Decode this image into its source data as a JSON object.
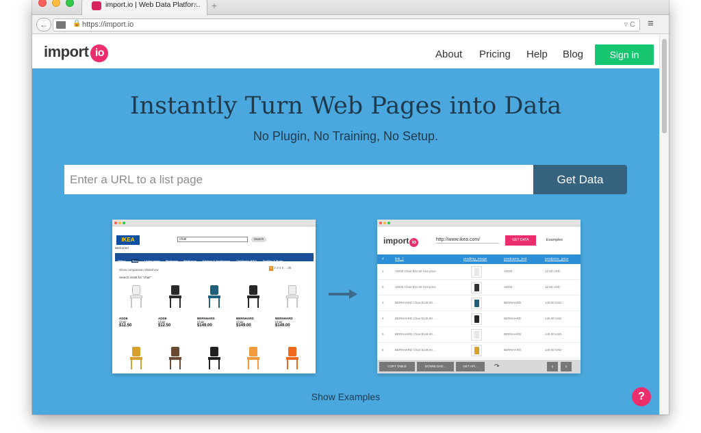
{
  "browser": {
    "tab_title": "import.io | Web Data Platfor…",
    "tab_close": "×",
    "new_tab": "+",
    "url": "https://import.io",
    "url_right": "▿ C",
    "menu": "≡",
    "back": "←"
  },
  "header": {
    "logo_text": "import",
    "logo_badge": "io",
    "nav": [
      "About",
      "Pricing",
      "Help",
      "Blog"
    ],
    "signin": "Sign in"
  },
  "hero": {
    "title": "Instantly Turn Web Pages into Data",
    "subtitle": "No Plugin, No Training, No Setup.",
    "input_placeholder": "Enter a URL to a list page",
    "cta": "Get Data"
  },
  "left_preview": {
    "logo": "IKEA",
    "welcome": "Welcome!",
    "search_value": "chair",
    "search_button": "Search",
    "menu": [
      "Offers",
      "New",
      "Living room",
      "Bedroom",
      "Bathroom",
      "Kitchen & Appliances",
      "Children's IKEA",
      "Textiles & Rugs"
    ],
    "tools": "Show comparison   Slideshow",
    "pages": [
      "1",
      "2",
      "3",
      "4",
      "5",
      "...",
      "25"
    ],
    "result_text": "Search result for \"chair\"",
    "products": [
      {
        "name": "ADDE",
        "type": "Chair",
        "price": "$12.50",
        "color": "#f0f0f0"
      },
      {
        "name": "ADDE",
        "type": "Chair",
        "price": "$12.50",
        "color": "#2a2a2a"
      },
      {
        "name": "BERNHARD",
        "type": "Chair",
        "price": "$149.00",
        "color": "#1f5f7a"
      },
      {
        "name": "BERNHARD",
        "type": "Chair",
        "price": "$149.00",
        "color": "#262626"
      },
      {
        "name": "BERNHARD",
        "type": "Chair",
        "price": "$149.00",
        "color": "#eeeeee"
      }
    ],
    "products_row2_colors": [
      "#d7a12c",
      "#6b4a33",
      "#202020",
      "#f29a3c",
      "#ef6a1e"
    ]
  },
  "right_preview": {
    "logo_text": "import",
    "logo_badge": "io",
    "url": "http://www.ikea.com/",
    "get_data": "GET DATA",
    "examples": "Examples",
    "columns": [
      "#",
      "link_1",
      "prodimg_image",
      "prodname_text",
      "prodprice_price"
    ],
    "rows": [
      {
        "n": "1",
        "link": "ADDE Chair $12.50 Unit price",
        "name": "ADDE",
        "price": "12.50 USD",
        "thumb": "#e8e8e8"
      },
      {
        "n": "2",
        "link": "ADDE Chair $12.50 Unit price",
        "name": "ADDE",
        "price": "12.50 USD",
        "thumb": "#333333"
      },
      {
        "n": "3",
        "link": "BERNHARD Chair $149.00 ...",
        "name": "BERNHARD",
        "price": "149.00 USD",
        "thumb": "#1f5f7a"
      },
      {
        "n": "4",
        "link": "BERNHARD Chair $149.00 ...",
        "name": "BERNHARD",
        "price": "149.00 USD",
        "thumb": "#262626"
      },
      {
        "n": "5",
        "link": "BERNHARD Chair $149.00 ...",
        "name": "BERNHARD",
        "price": "149.00 USD",
        "thumb": "#e6e6e6"
      },
      {
        "n": "6",
        "link": "BERNHARD Chair $149.00 ...",
        "name": "BERNHARD",
        "price": "149.00 USD",
        "thumb": "#d7a12c"
      }
    ],
    "footer": [
      "COPY TABLE",
      "DOWNLOAD...",
      "GET API..."
    ],
    "share": "↷",
    "prev": "‹",
    "next": "›"
  },
  "show_examples": "Show Examples",
  "help": "?",
  "colors": {
    "hero_bg": "#4aa8de",
    "signin_bg": "#17c46f",
    "cta_bg": "#35627f",
    "brand_pink": "#ec2f6c"
  }
}
